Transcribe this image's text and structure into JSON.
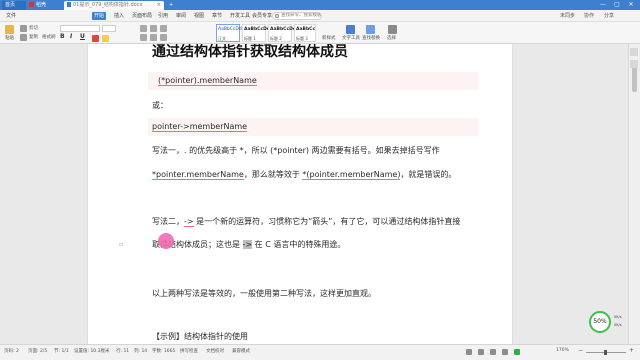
{
  "titlebar": {
    "home_tab": "首页",
    "app_tab": "稻壳",
    "doc_tab": "01提示_079_结构体指针.docx",
    "new_tab": "+",
    "minimize": "—",
    "maximize": "▢",
    "close": "✕"
  },
  "menubar": {
    "items": [
      "文件",
      "开始",
      "插入",
      "页面布局",
      "引用",
      "审阅",
      "视图",
      "章节",
      "开发工具",
      "会员专享"
    ],
    "search_placeholder": "查找命令、搜索模板",
    "right_items": [
      "未同步",
      "协作",
      "分享"
    ]
  },
  "toolbar": {
    "paste": "粘贴",
    "cut": "剪切",
    "copy": "复制",
    "format_painter": "格式刷",
    "bold": "B",
    "italic": "I",
    "underline": "U",
    "styles": [
      {
        "sample": "AaBbCcDd",
        "label": "正文"
      },
      {
        "sample": "AaBbCcDd",
        "label": "标题 1"
      },
      {
        "sample": "AaBbCcDd",
        "label": "标题 2"
      },
      {
        "sample": "AaBbCc",
        "label": "标题 3"
      }
    ],
    "new_style": "新样式",
    "text_tools": "文字工具",
    "find_replace": "查找替换",
    "select": "选择"
  },
  "document": {
    "heading": "通过结构体指针获取结构体成员",
    "code1": "(*pointer).memberName",
    "or": "或：",
    "code2": "pointer->memberName",
    "para1": "写法一，. 的优先级高于 *，所以 (*pointer) 两边需要有括号。如果去掉括号写作",
    "para2a": "*pointer.memberName",
    "para2b": "，那么就等效于 ",
    "para2c": "*(pointer.memberName)",
    "para2d": "，就是错误的。",
    "para3a": "写法二，",
    "para3b": "->",
    "para3c": " 是一个新的运算符，习惯称它为“箭头”，有了它，可以通过结构体指针直接",
    "para4a": "取得结构体成员；这也是 ",
    "para4b": "->",
    "para4c": " 在 C 语言中的特殊用途。",
    "para5": "以上两种写法是等效的，一般使用第二种写法，这样更加直观。",
    "next_heading": "【示例】结构体指针的使用"
  },
  "widgets": {
    "speed": "50%",
    "net_up": "0K/s",
    "net_down": "0K/s"
  },
  "statusbar": {
    "page": "页码: 2",
    "pages": "页面: 2/5",
    "section": "节: 1/1",
    "setting": "设置值: 10.3厘米",
    "row": "行: 11",
    "col": "列: 14",
    "words": "字数: 1665",
    "spell": "拼写检查",
    "doc_check": "文档校对",
    "compat": "兼容模式",
    "zoom": "170%"
  },
  "colors": {
    "accent": "#3f7fd0",
    "cursor_highlight": "#f06bb0",
    "speed_ring": "#3fbf4a",
    "underline": "#ff6a6a"
  }
}
